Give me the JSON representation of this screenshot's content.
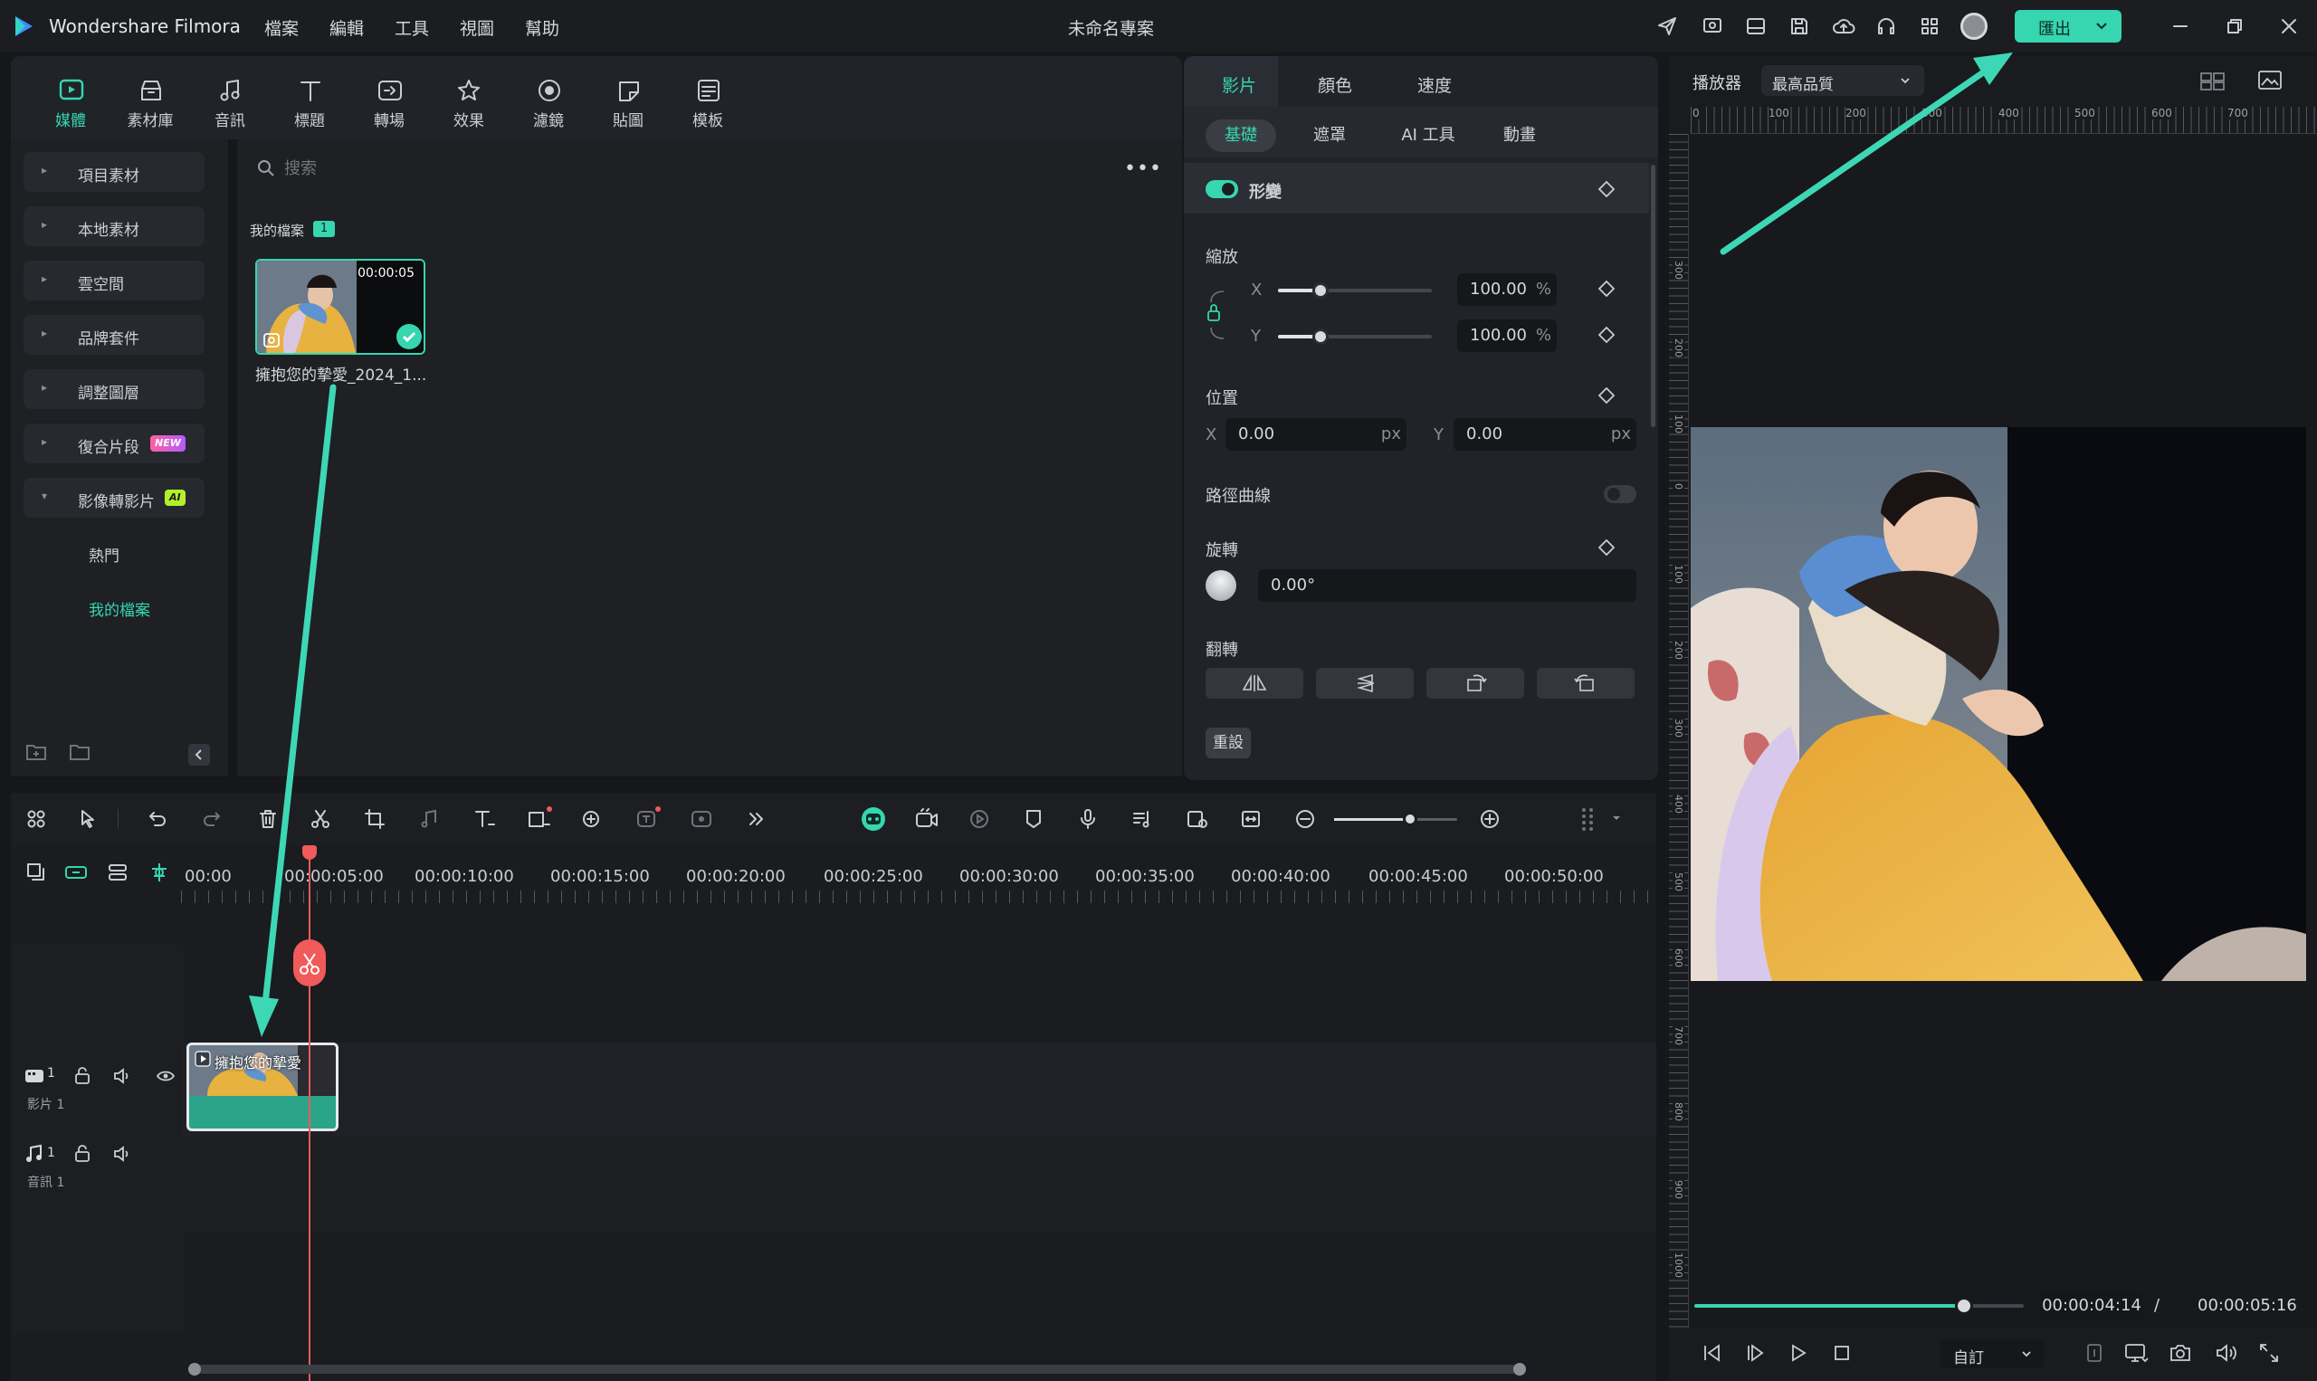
{
  "app": {
    "name": "Wondershare Filmora",
    "project_title": "未命名專案",
    "export_label": "匯出"
  },
  "menu": [
    "檔案",
    "編輯",
    "工具",
    "視圖",
    "幫助"
  ],
  "toolbar": [
    {
      "label": "媒體",
      "icon": "media-icon",
      "active": true
    },
    {
      "label": "素材庫",
      "icon": "stock-library-icon"
    },
    {
      "label": "音訊",
      "icon": "audio-icon"
    },
    {
      "label": "標題",
      "icon": "title-icon"
    },
    {
      "label": "轉場",
      "icon": "transition-icon"
    },
    {
      "label": "效果",
      "icon": "effects-icon"
    },
    {
      "label": "濾鏡",
      "icon": "filter-icon"
    },
    {
      "label": "貼圖",
      "icon": "sticker-icon"
    },
    {
      "label": "模板",
      "icon": "template-icon"
    }
  ],
  "sidebar": {
    "items": [
      {
        "label": "項目素材"
      },
      {
        "label": "本地素材"
      },
      {
        "label": "雲空間"
      },
      {
        "label": "品牌套件"
      },
      {
        "label": "調整圖層"
      },
      {
        "label": "復合片段",
        "badge": "NEW"
      },
      {
        "label": "影像轉影片",
        "badge": "AI",
        "expanded": true
      }
    ],
    "sub_items": [
      {
        "label": "熱門"
      },
      {
        "label": "我的檔案",
        "active": true
      }
    ]
  },
  "media": {
    "search_placeholder": "搜索",
    "section_title": "我的檔案",
    "section_count": "1",
    "clip": {
      "duration": "00:00:05",
      "name": "擁抱您的摯愛_2024_1..."
    }
  },
  "properties": {
    "tabs": [
      "影片",
      "顏色",
      "速度"
    ],
    "active_tab": "影片",
    "subtabs": [
      "基礎",
      "遮罩",
      "AI 工具",
      "動畫"
    ],
    "active_subtab": "基礎",
    "transform_label": "形變",
    "scale_label": "縮放",
    "scale_x": "100.00",
    "scale_y": "100.00",
    "percent": "%",
    "x_label": "X",
    "y_label": "Y",
    "position_label": "位置",
    "position_x": "0.00",
    "position_y": "0.00",
    "px": "px",
    "path_curve_label": "路徑曲線",
    "rotation_label": "旋轉",
    "rotation_value": "0.00°",
    "flip_label": "翻轉",
    "reset_label": "重設"
  },
  "player": {
    "label": "播放器",
    "quality": "最高品質",
    "ruler_top": [
      "0",
      "100",
      "200",
      "300",
      "400",
      "500",
      "600",
      "700"
    ],
    "ruler_left": [
      "300",
      "200",
      "100",
      "0",
      "100",
      "200",
      "300",
      "400",
      "500",
      "600",
      "700",
      "800",
      "900",
      "1000"
    ],
    "current_time": "00:00:04:14",
    "separator": "/",
    "total_time": "00:00:05:16",
    "progress": 0.82,
    "zoom": "自訂"
  },
  "timeline": {
    "ticks": [
      "00:00",
      "00:00:05:00",
      "00:00:10:00",
      "00:00:15:00",
      "00:00:20:00",
      "00:00:25:00",
      "00:00:30:00",
      "00:00:35:00",
      "00:00:40:00",
      "00:00:45:00",
      "00:00:50:00"
    ],
    "video_track_label": "影片 1",
    "video_track_num": "1",
    "audio_track_label": "音訊 1",
    "audio_track_num": "1",
    "clip_title": "擁抱您的摯愛"
  },
  "colors": {
    "accent": "#35d6b0",
    "playhead": "#f05a5a",
    "background": "#15171a",
    "panel": "#202328"
  }
}
